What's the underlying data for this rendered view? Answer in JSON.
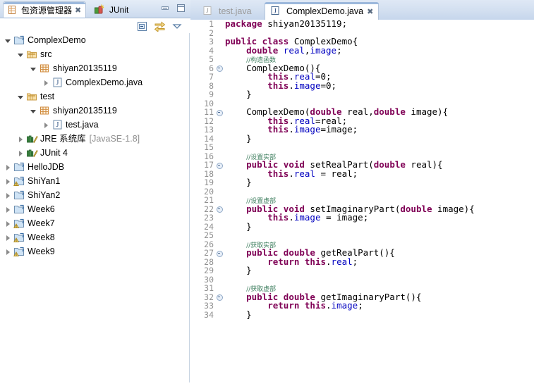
{
  "left_panel": {
    "tabs": [
      {
        "label": "包资源管理器",
        "icon": "package-explorer-icon",
        "active": true,
        "closable": true
      },
      {
        "label": "JUnit",
        "icon": "junit-icon",
        "active": false,
        "closable": false
      }
    ],
    "window_buttons": [
      {
        "name": "minimize-button",
        "glyph": "minimize"
      },
      {
        "name": "maximize-button",
        "glyph": "maximize"
      }
    ],
    "toolbar": [
      {
        "name": "collapse-all-button",
        "icon": "collapse-all-icon"
      },
      {
        "name": "link-with-editor-button",
        "icon": "link-with-editor-icon"
      },
      {
        "name": "view-menu-button",
        "icon": "chevron-down-icon"
      }
    ],
    "tree": [
      {
        "label": "ComplexDemo",
        "sub": "",
        "depth": 0,
        "arrow": "open",
        "icon": "java-project-icon"
      },
      {
        "label": "src",
        "sub": "",
        "depth": 1,
        "arrow": "open",
        "icon": "source-folder-icon"
      },
      {
        "label": "shiyan20135119",
        "sub": "",
        "depth": 2,
        "arrow": "open",
        "icon": "package-icon"
      },
      {
        "label": "ComplexDemo.java",
        "sub": "",
        "depth": 3,
        "arrow": "closed",
        "icon": "java-file-icon"
      },
      {
        "label": "test",
        "sub": "",
        "depth": 1,
        "arrow": "open",
        "icon": "source-folder-icon"
      },
      {
        "label": "shiyan20135119",
        "sub": "",
        "depth": 2,
        "arrow": "open",
        "icon": "package-icon"
      },
      {
        "label": "test.java",
        "sub": "",
        "depth": 3,
        "arrow": "closed",
        "icon": "java-file-icon"
      },
      {
        "label": "JRE 系统库",
        "sub": "[JavaSE-1.8]",
        "depth": 1,
        "arrow": "closed",
        "icon": "library-icon"
      },
      {
        "label": "JUnit 4",
        "sub": "",
        "depth": 1,
        "arrow": "closed",
        "icon": "library-icon"
      },
      {
        "label": "HelloJDB",
        "sub": "",
        "depth": 0,
        "arrow": "closed",
        "icon": "java-project-icon"
      },
      {
        "label": "ShiYan1",
        "sub": "",
        "depth": 0,
        "arrow": "closed",
        "icon": "java-project-warning-icon"
      },
      {
        "label": "ShiYan2",
        "sub": "",
        "depth": 0,
        "arrow": "closed",
        "icon": "java-project-icon"
      },
      {
        "label": "Week6",
        "sub": "",
        "depth": 0,
        "arrow": "closed",
        "icon": "java-project-icon"
      },
      {
        "label": "Week7",
        "sub": "",
        "depth": 0,
        "arrow": "closed",
        "icon": "java-project-warning-icon"
      },
      {
        "label": "Week8",
        "sub": "",
        "depth": 0,
        "arrow": "closed",
        "icon": "java-project-warning-icon"
      },
      {
        "label": "Week9",
        "sub": "",
        "depth": 0,
        "arrow": "closed",
        "icon": "java-project-warning-icon"
      }
    ]
  },
  "editor": {
    "tabs": [
      {
        "label": "test.java",
        "active": false,
        "closable": false,
        "icon": "java-file-icon"
      },
      {
        "label": "ComplexDemo.java",
        "active": true,
        "closable": true,
        "icon": "java-file-icon"
      }
    ],
    "first_line_number": 1,
    "last_line_number": 34,
    "fold_lines": [
      6,
      11,
      17,
      22,
      27,
      32
    ],
    "lines": [
      {
        "n": 1,
        "tokens": [
          {
            "t": "kw",
            "s": "package"
          },
          {
            "t": "pl",
            "s": " shiyan20135119;"
          }
        ]
      },
      {
        "n": 2,
        "tokens": []
      },
      {
        "n": 3,
        "tokens": [
          {
            "t": "kw",
            "s": "public class"
          },
          {
            "t": "pl",
            "s": " ComplexDemo{"
          }
        ]
      },
      {
        "n": 4,
        "tokens": [
          {
            "t": "pl",
            "s": "    "
          },
          {
            "t": "kw",
            "s": "double"
          },
          {
            "t": "pl",
            "s": " "
          },
          {
            "t": "fld",
            "s": "real"
          },
          {
            "t": "pl",
            "s": ","
          },
          {
            "t": "fld",
            "s": "image"
          },
          {
            "t": "pl",
            "s": ";"
          }
        ]
      },
      {
        "n": 5,
        "tokens": [
          {
            "t": "pl",
            "s": "    "
          },
          {
            "t": "cm",
            "s": "//构造函数"
          }
        ]
      },
      {
        "n": 6,
        "tokens": [
          {
            "t": "pl",
            "s": "    ComplexDemo(){"
          }
        ]
      },
      {
        "n": 7,
        "tokens": [
          {
            "t": "pl",
            "s": "        "
          },
          {
            "t": "ths",
            "s": "this"
          },
          {
            "t": "pl",
            "s": "."
          },
          {
            "t": "fld",
            "s": "real"
          },
          {
            "t": "pl",
            "s": "=0;"
          }
        ]
      },
      {
        "n": 8,
        "tokens": [
          {
            "t": "pl",
            "s": "        "
          },
          {
            "t": "ths",
            "s": "this"
          },
          {
            "t": "pl",
            "s": "."
          },
          {
            "t": "fld",
            "s": "image"
          },
          {
            "t": "pl",
            "s": "=0;"
          }
        ]
      },
      {
        "n": 9,
        "tokens": [
          {
            "t": "pl",
            "s": "    }"
          }
        ]
      },
      {
        "n": 10,
        "tokens": []
      },
      {
        "n": 11,
        "tokens": [
          {
            "t": "pl",
            "s": "    ComplexDemo("
          },
          {
            "t": "kw",
            "s": "double"
          },
          {
            "t": "pl",
            "s": " real,"
          },
          {
            "t": "kw",
            "s": "double"
          },
          {
            "t": "pl",
            "s": " image){"
          }
        ]
      },
      {
        "n": 12,
        "tokens": [
          {
            "t": "pl",
            "s": "        "
          },
          {
            "t": "ths",
            "s": "this"
          },
          {
            "t": "pl",
            "s": "."
          },
          {
            "t": "fld",
            "s": "real"
          },
          {
            "t": "pl",
            "s": "=real;"
          }
        ]
      },
      {
        "n": 13,
        "tokens": [
          {
            "t": "pl",
            "s": "        "
          },
          {
            "t": "ths",
            "s": "this"
          },
          {
            "t": "pl",
            "s": "."
          },
          {
            "t": "fld",
            "s": "image"
          },
          {
            "t": "pl",
            "s": "=image;"
          }
        ]
      },
      {
        "n": 14,
        "tokens": [
          {
            "t": "pl",
            "s": "    }"
          }
        ]
      },
      {
        "n": 15,
        "tokens": []
      },
      {
        "n": 16,
        "tokens": [
          {
            "t": "pl",
            "s": "    "
          },
          {
            "t": "cm",
            "s": "//设置实部"
          }
        ]
      },
      {
        "n": 17,
        "tokens": [
          {
            "t": "pl",
            "s": "    "
          },
          {
            "t": "kw",
            "s": "public void"
          },
          {
            "t": "pl",
            "s": " setRealPart("
          },
          {
            "t": "kw",
            "s": "double"
          },
          {
            "t": "pl",
            "s": " real){"
          }
        ]
      },
      {
        "n": 18,
        "tokens": [
          {
            "t": "pl",
            "s": "        "
          },
          {
            "t": "ths",
            "s": "this"
          },
          {
            "t": "pl",
            "s": "."
          },
          {
            "t": "fld",
            "s": "real"
          },
          {
            "t": "pl",
            "s": " = real;"
          }
        ]
      },
      {
        "n": 19,
        "tokens": [
          {
            "t": "pl",
            "s": "    }"
          }
        ]
      },
      {
        "n": 20,
        "tokens": []
      },
      {
        "n": 21,
        "tokens": [
          {
            "t": "pl",
            "s": "    "
          },
          {
            "t": "cm",
            "s": "//设置虚部"
          }
        ]
      },
      {
        "n": 22,
        "tokens": [
          {
            "t": "pl",
            "s": "    "
          },
          {
            "t": "kw",
            "s": "public void"
          },
          {
            "t": "pl",
            "s": " setImaginaryPart("
          },
          {
            "t": "kw",
            "s": "double"
          },
          {
            "t": "pl",
            "s": " image){"
          }
        ]
      },
      {
        "n": 23,
        "tokens": [
          {
            "t": "pl",
            "s": "        "
          },
          {
            "t": "ths",
            "s": "this"
          },
          {
            "t": "pl",
            "s": "."
          },
          {
            "t": "fld",
            "s": "image"
          },
          {
            "t": "pl",
            "s": " = image;"
          }
        ]
      },
      {
        "n": 24,
        "tokens": [
          {
            "t": "pl",
            "s": "    }"
          }
        ]
      },
      {
        "n": 25,
        "tokens": []
      },
      {
        "n": 26,
        "tokens": [
          {
            "t": "pl",
            "s": "    "
          },
          {
            "t": "cm",
            "s": "//获取实部"
          }
        ]
      },
      {
        "n": 27,
        "tokens": [
          {
            "t": "pl",
            "s": "    "
          },
          {
            "t": "kw",
            "s": "public double"
          },
          {
            "t": "pl",
            "s": " getRealPart(){"
          }
        ]
      },
      {
        "n": 28,
        "tokens": [
          {
            "t": "pl",
            "s": "        "
          },
          {
            "t": "kw",
            "s": "return"
          },
          {
            "t": "pl",
            "s": " "
          },
          {
            "t": "ths",
            "s": "this"
          },
          {
            "t": "pl",
            "s": "."
          },
          {
            "t": "fld",
            "s": "real"
          },
          {
            "t": "pl",
            "s": ";"
          }
        ]
      },
      {
        "n": 29,
        "tokens": [
          {
            "t": "pl",
            "s": "    }"
          }
        ]
      },
      {
        "n": 30,
        "tokens": []
      },
      {
        "n": 31,
        "tokens": [
          {
            "t": "pl",
            "s": "    "
          },
          {
            "t": "cm",
            "s": "//获取虚部"
          }
        ]
      },
      {
        "n": 32,
        "tokens": [
          {
            "t": "pl",
            "s": "    "
          },
          {
            "t": "kw",
            "s": "public double"
          },
          {
            "t": "pl",
            "s": " getImaginaryPart(){"
          }
        ]
      },
      {
        "n": 33,
        "tokens": [
          {
            "t": "pl",
            "s": "        "
          },
          {
            "t": "kw",
            "s": "return"
          },
          {
            "t": "pl",
            "s": " "
          },
          {
            "t": "ths",
            "s": "this"
          },
          {
            "t": "pl",
            "s": "."
          },
          {
            "t": "fld",
            "s": "image"
          },
          {
            "t": "pl",
            "s": ";"
          }
        ]
      },
      {
        "n": 34,
        "tokens": [
          {
            "t": "pl",
            "s": "    }"
          }
        ]
      }
    ]
  },
  "colors": {
    "keyword": "#7f0055",
    "field": "#0000c0",
    "comment": "#3f7f5f",
    "tab_active_bg": "#ffffff",
    "tab_bar_bg": "#cbdaee",
    "gutter_text": "#909090"
  }
}
